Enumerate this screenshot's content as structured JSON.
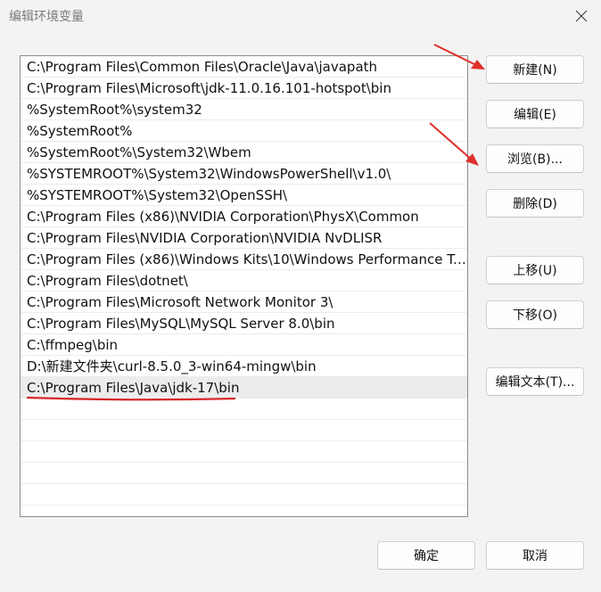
{
  "dialog": {
    "title": "编辑环境变量"
  },
  "list": {
    "items": [
      "C:\\Program Files\\Common Files\\Oracle\\Java\\javapath",
      "C:\\Program Files\\Microsoft\\jdk-11.0.16.101-hotspot\\bin",
      "%SystemRoot%\\system32",
      "%SystemRoot%",
      "%SystemRoot%\\System32\\Wbem",
      "%SYSTEMROOT%\\System32\\WindowsPowerShell\\v1.0\\",
      "%SYSTEMROOT%\\System32\\OpenSSH\\",
      "C:\\Program Files (x86)\\NVIDIA Corporation\\PhysX\\Common",
      "C:\\Program Files\\NVIDIA Corporation\\NVIDIA NvDLISR",
      "C:\\Program Files (x86)\\Windows Kits\\10\\Windows Performance To...",
      "C:\\Program Files\\dotnet\\",
      "C:\\Program Files\\Microsoft Network Monitor 3\\",
      "C:\\Program Files\\MySQL\\MySQL Server 8.0\\bin",
      "C:\\ffmpeg\\bin",
      "D:\\新建文件夹\\curl-8.5.0_3-win64-mingw\\bin",
      "C:\\Program Files\\Java\\jdk-17\\bin"
    ],
    "selected_index": 15
  },
  "buttons": {
    "new": "新建(N)",
    "edit": "编辑(E)",
    "browse": "浏览(B)...",
    "delete": "删除(D)",
    "move_up": "上移(U)",
    "move_down": "下移(O)",
    "edit_text": "编辑文本(T)...",
    "ok": "确定",
    "cancel": "取消"
  },
  "colors": {
    "annotation_red": "#e0302a"
  },
  "icons": {
    "close": "close-icon"
  }
}
